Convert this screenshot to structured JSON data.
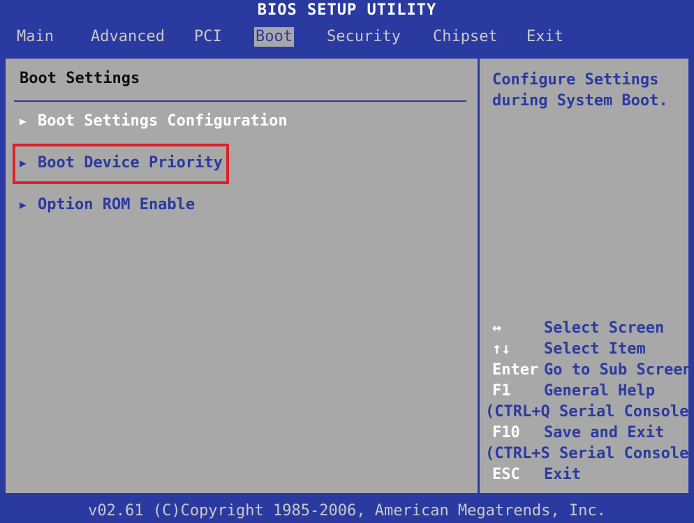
{
  "header": {
    "title": "BIOS SETUP UTILITY"
  },
  "menu": {
    "items": [
      {
        "label": "Main"
      },
      {
        "label": "Advanced"
      },
      {
        "label": "PCI"
      },
      {
        "label": "Boot",
        "active": true
      },
      {
        "label": "Security"
      },
      {
        "label": "Chipset"
      },
      {
        "label": "Exit"
      }
    ]
  },
  "main": {
    "section_title": "Boot Settings",
    "entries": [
      {
        "label": "Boot Settings Configuration"
      },
      {
        "label": "Boot Device Priority",
        "highlighted": true
      },
      {
        "label": "Option ROM Enable"
      }
    ]
  },
  "help": {
    "text": "Configure Settings during System Boot."
  },
  "keys": [
    {
      "key": "↔",
      "desc": "Select Screen"
    },
    {
      "key": "↑↓",
      "desc": "Select Item"
    },
    {
      "key": "Enter",
      "desc": "Go to Sub Screen"
    },
    {
      "key": "F1",
      "desc": "General Help"
    },
    {
      "key": "",
      "desc": "(CTRL+Q Serial Console)"
    },
    {
      "key": "F10",
      "desc": "Save and Exit"
    },
    {
      "key": "",
      "desc": "(CTRL+S Serial Console)"
    },
    {
      "key": "ESC",
      "desc": "Exit"
    }
  ],
  "footer": {
    "text": "v02.61 (C)Copyright 1985-2006, American Megatrends, Inc."
  },
  "colors": {
    "background_blue": "#2b3aa0",
    "panel_gray": "#a8a8a8",
    "highlight_red": "#e0202a",
    "text_white": "#ffffff"
  }
}
